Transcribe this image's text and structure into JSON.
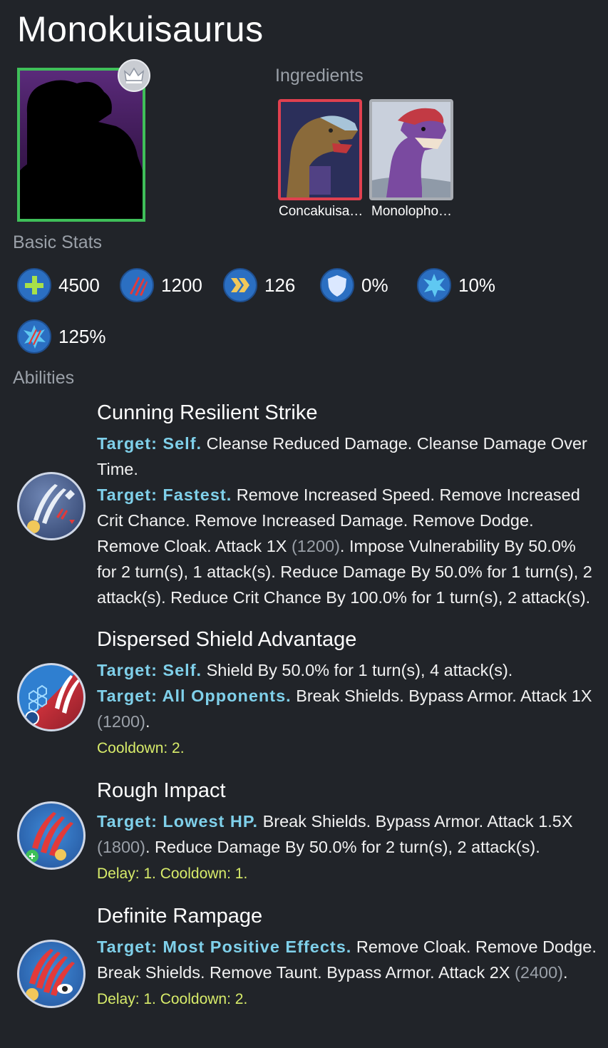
{
  "creature": {
    "name": "Monokuisaurus"
  },
  "ingredients": {
    "label": "Ingredients",
    "items": [
      {
        "name": "Concakuisa…",
        "border": "#e0404f"
      },
      {
        "name": "Monolopho…",
        "border": "#a9adb3"
      }
    ]
  },
  "basic_stats": {
    "label": "Basic Stats",
    "items": [
      {
        "icon": "health-icon",
        "value": "4500"
      },
      {
        "icon": "damage-icon",
        "value": "1200"
      },
      {
        "icon": "speed-icon",
        "value": "126"
      },
      {
        "icon": "armor-icon",
        "value": "0%"
      },
      {
        "icon": "crit-chance-icon",
        "value": "10%"
      },
      {
        "icon": "crit-damage-icon",
        "value": "125%"
      }
    ]
  },
  "abilities": {
    "label": "Abilities",
    "items": [
      {
        "name": "Cunning Resilient Strike",
        "lines": [
          {
            "target": "Target: Self.",
            "text": " Cleanse Reduced Damage. Cleanse Damage Over Time."
          },
          {
            "target": "Target: Fastest.",
            "text": " Remove Increased Speed. Remove Increased Crit Chance. Remove Increased Damage. Remove Dodge. Remove Cloak. Attack 1X ",
            "dmg": "(1200)",
            "tail": ". Impose Vulnerability By 50.0% for 2 turn(s), 1 attack(s). Reduce Damage By 50.0% for 1 turn(s), 2 attack(s). Reduce Crit Chance By 100.0% for 1 turn(s), 2 attack(s)."
          }
        ],
        "cooldown": ""
      },
      {
        "name": "Dispersed Shield Advantage",
        "lines": [
          {
            "target": "Target: Self.",
            "text": " Shield By 50.0% for 1 turn(s), 4 attack(s)."
          },
          {
            "target": "Target: All Opponents.",
            "text": " Break Shields. Bypass Armor. Attack 1X ",
            "dmg": "(1200)",
            "tail": "."
          }
        ],
        "cooldown": "Cooldown: 2."
      },
      {
        "name": "Rough Impact",
        "lines": [
          {
            "target": "Target: Lowest HP.",
            "text": " Break Shields. Bypass Armor. Attack 1.5X ",
            "dmg": "(1800)",
            "tail": ". Reduce Damage By 50.0% for 2 turn(s), 2 attack(s)."
          }
        ],
        "cooldown": "Delay: 1. Cooldown: 1."
      },
      {
        "name": "Definite Rampage",
        "lines": [
          {
            "target": "Target: Most Positive Effects.",
            "text": " Remove Cloak. Remove Dodge. Break Shields. Remove Taunt. Bypass Armor. Attack 2X ",
            "dmg": "(2400)",
            "tail": "."
          }
        ],
        "cooldown": "Delay: 1. Cooldown: 2."
      }
    ]
  },
  "colors": {
    "background": "#212429",
    "target": "#7fd0ea",
    "cooldown": "#d8ec6a",
    "label": "#9aa0a8",
    "portrait_border": "#3fbf59"
  }
}
